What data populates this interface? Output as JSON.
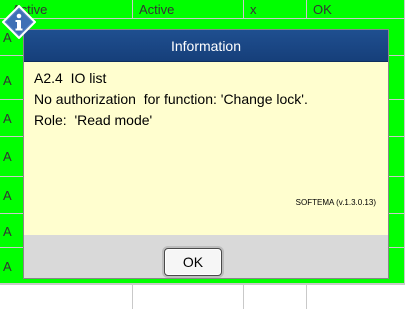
{
  "background_table": {
    "header_cells": [
      "Active",
      "Active",
      "x",
      "OK"
    ],
    "row_letters": [
      "A",
      "A",
      "A",
      "A",
      "A",
      "A",
      "A"
    ]
  },
  "dialog": {
    "title": "Information",
    "lines": [
      "A2.4  IO list",
      "No authorization  for function: 'Change lock'.",
      "Role:  'Read mode'"
    ],
    "version": "SOFTEMA  (v.1.3.0.13)",
    "ok_label": "OK",
    "icon": "info-diamond-icon"
  },
  "colors": {
    "grid_green": "#00ff00",
    "title_bar": "#1f4f90",
    "dialog_body": "#fffecf",
    "footer": "#d9d9d9"
  }
}
